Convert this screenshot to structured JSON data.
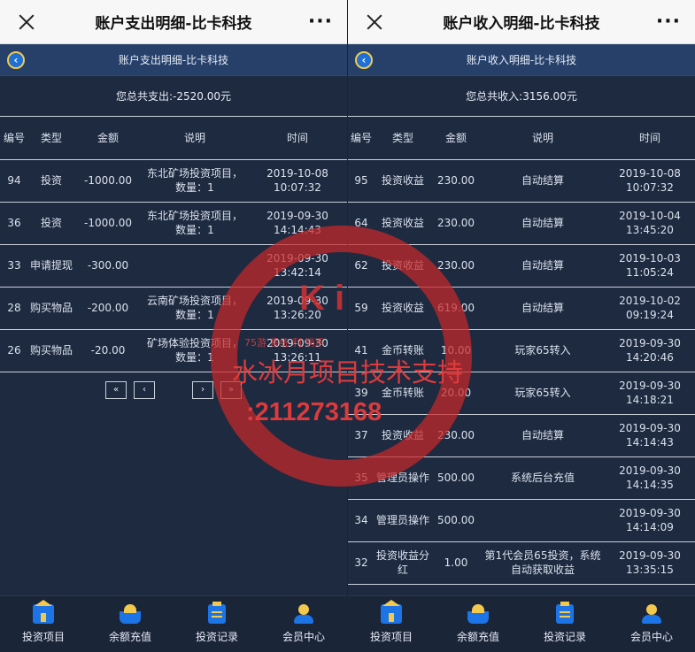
{
  "left": {
    "window_title": "账户支出明细-比卡科技",
    "subtitle": "账户支出明细-比卡科技",
    "total_label": "您总共支出: ",
    "total_value": "-2520.00元",
    "headers": [
      "编号",
      "类型",
      "金额",
      "说明",
      "时间"
    ],
    "rows": [
      [
        "94",
        "投资",
        "-1000.00",
        "东北矿场投资项目，数量：1",
        "2019-10-08 10:07:32"
      ],
      [
        "36",
        "投资",
        "-1000.00",
        "东北矿场投资项目，数量：1",
        "2019-09-30 14:14:43"
      ],
      [
        "33",
        "申请提现",
        "-300.00",
        "",
        "2019-09-30 13:42:14"
      ],
      [
        "28",
        "购买物品",
        "-200.00",
        "云南矿场投资项目，数量：1",
        "2019-09-30 13:26:20"
      ],
      [
        "26",
        "购买物品",
        "-20.00",
        "矿场体验投资项目，数量：1",
        "2019-09-30 13:26:11"
      ]
    ],
    "pager": [
      "«",
      "‹",
      "›",
      "»"
    ]
  },
  "right": {
    "window_title": "账户收入明细-比卡科技",
    "subtitle": "账户收入明细-比卡科技",
    "total_label": "您总共收入: ",
    "total_value": "3156.00元",
    "headers": [
      "编号",
      "类型",
      "金额",
      "说明",
      "时间"
    ],
    "rows": [
      [
        "95",
        "投资收益",
        "230.00",
        "自动结算",
        "2019-10-08 10:07:32"
      ],
      [
        "64",
        "投资收益",
        "230.00",
        "自动结算",
        "2019-10-04 13:45:20"
      ],
      [
        "62",
        "投资收益",
        "230.00",
        "自动结算",
        "2019-10-03 11:05:24"
      ],
      [
        "59",
        "投资收益",
        "619.00",
        "自动结算",
        "2019-10-02 09:19:24"
      ],
      [
        "41",
        "金币转账",
        "10.00",
        "玩家65转入",
        "2019-09-30 14:20:46"
      ],
      [
        "39",
        "金币转账",
        "20.00",
        "玩家65转入",
        "2019-09-30 14:18:21"
      ],
      [
        "37",
        "投资收益",
        "230.00",
        "自动结算",
        "2019-09-30 14:14:43"
      ],
      [
        "35",
        "管理员操作",
        "500.00",
        "系统后台充值",
        "2019-09-30 14:14:35"
      ],
      [
        "34",
        "管理员操作",
        "500.00",
        "",
        "2019-09-30 14:14:09"
      ],
      [
        "32",
        "投资收益分红",
        "1.00",
        "第1代会员65投资，系统自动获取收益",
        "2019-09-30 13:35:15"
      ]
    ]
  },
  "nav": [
    "投资项目",
    "余额充值",
    "投资记录",
    "会员中心"
  ],
  "watermark": {
    "logo": "K  i",
    "small": "75游  系统 利  销系",
    "line1": "水冰月项目技术支持",
    "line2": ":211273168"
  },
  "colors": {
    "bg": "#1e2a40",
    "accent": "#1c74e6",
    "gold": "#f2c94c",
    "stamp": "#c82828"
  }
}
